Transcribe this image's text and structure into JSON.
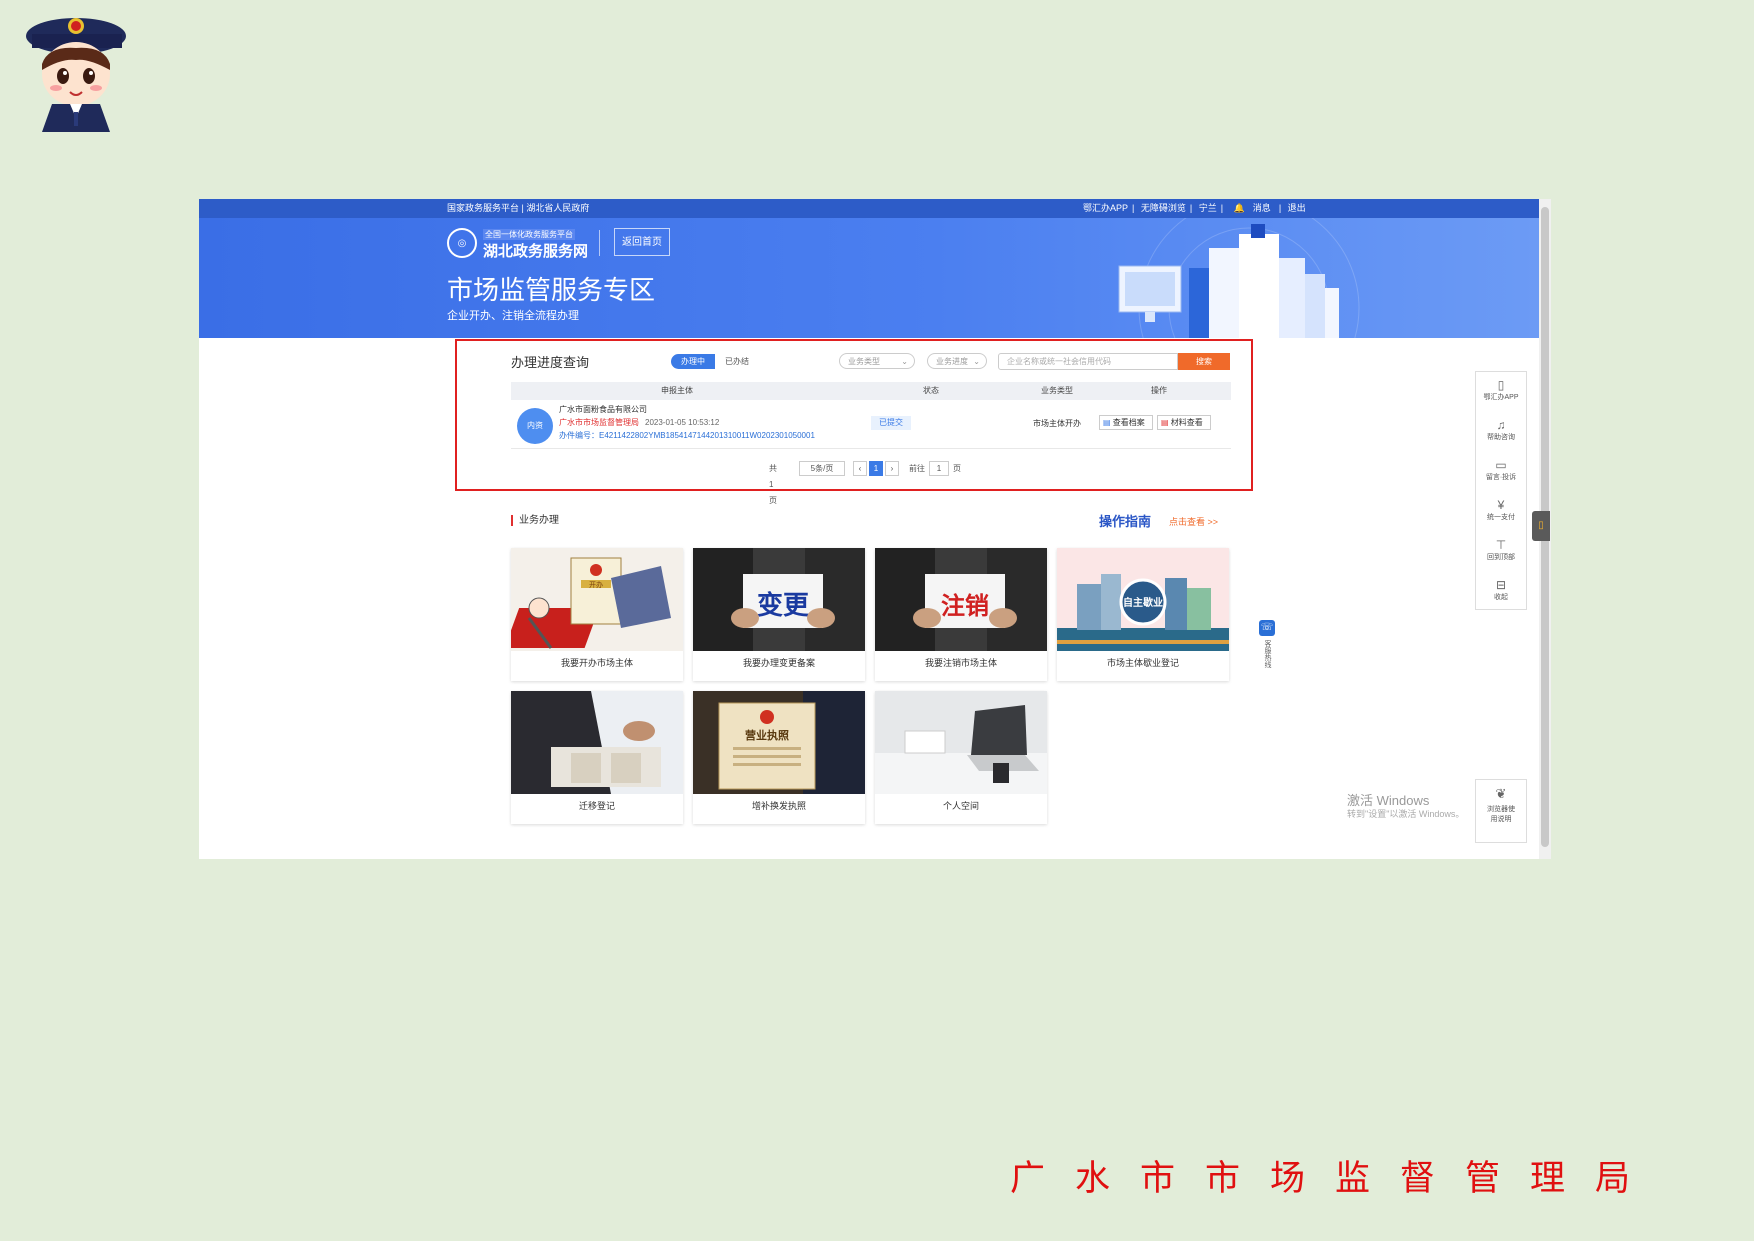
{
  "footer": {
    "org": "广水市市场监督管理局"
  },
  "topbar": {
    "left": "国家政务服务平台 | 湖北省人民政府",
    "right": [
      "鄂汇办APP",
      "无障碍浏览",
      "宁兰",
      "消息",
      "退出"
    ]
  },
  "banner": {
    "logo_top": "全国一体化政务服务平台",
    "logo_name": "湖北政务服务网",
    "home_button": "返回首页",
    "title": "市场监管服务专区",
    "subtitle": "企业开办、注销全流程办理"
  },
  "query": {
    "title": "办理进度查询",
    "tabs": [
      "办理中",
      "已办结"
    ],
    "select_type": "业务类型",
    "select_status": "业务进度",
    "search_placeholder": "企业名称或统一社会信用代码",
    "search_button": "搜索",
    "columns": [
      "申报主体",
      "状态",
      "业务类型",
      "操作"
    ],
    "row": {
      "avatar": "内资",
      "name": "广水市面粉食品有限公司",
      "org": "广水市市场监督管理局",
      "time": "2023-01-05 10:53:12",
      "number": "办件编号：E4211422802YMB1854147144201310011W0202301050001",
      "status": "已提交",
      "type": "市场主体开办",
      "op_view": "查看档案",
      "op_material": "材料查看"
    },
    "pager": {
      "total": "共1页",
      "per_page": "5条/页",
      "page": "1",
      "goto": "前往",
      "goto_value": "1",
      "page_suffix": "页"
    }
  },
  "services": {
    "title": "业务办理",
    "guide": "操作指南",
    "guide_link": "点击查看 >>",
    "cards": [
      {
        "label": "我要开办市场主体",
        "image": "开办"
      },
      {
        "label": "我要办理变更备案",
        "image": "变更"
      },
      {
        "label": "我要注销市场主体",
        "image": "注销"
      },
      {
        "label": "市场主体歇业登记",
        "image": "自主歇业"
      },
      {
        "label": "迁移登记",
        "image": ""
      },
      {
        "label": "增补换发执照",
        "image": "营业执照"
      },
      {
        "label": "个人空间",
        "image": ""
      }
    ]
  },
  "floatbar": {
    "items": [
      {
        "icon": "phone-icon",
        "label": "鄂汇办APP"
      },
      {
        "icon": "headset-icon",
        "label": "帮助咨询"
      },
      {
        "icon": "message-icon",
        "label": "留言·投诉"
      },
      {
        "icon": "yuan-icon",
        "label": "统一支付"
      },
      {
        "icon": "top-icon",
        "label": "回到顶部"
      },
      {
        "icon": "minus-icon",
        "label": "收起"
      }
    ],
    "browser_tip": "浏览器使用说明"
  },
  "phone_chip": "客服热线",
  "windows": {
    "title": "激活 Windows",
    "sub": "转到\"设置\"以激活 Windows。"
  },
  "side_tab": "▯"
}
